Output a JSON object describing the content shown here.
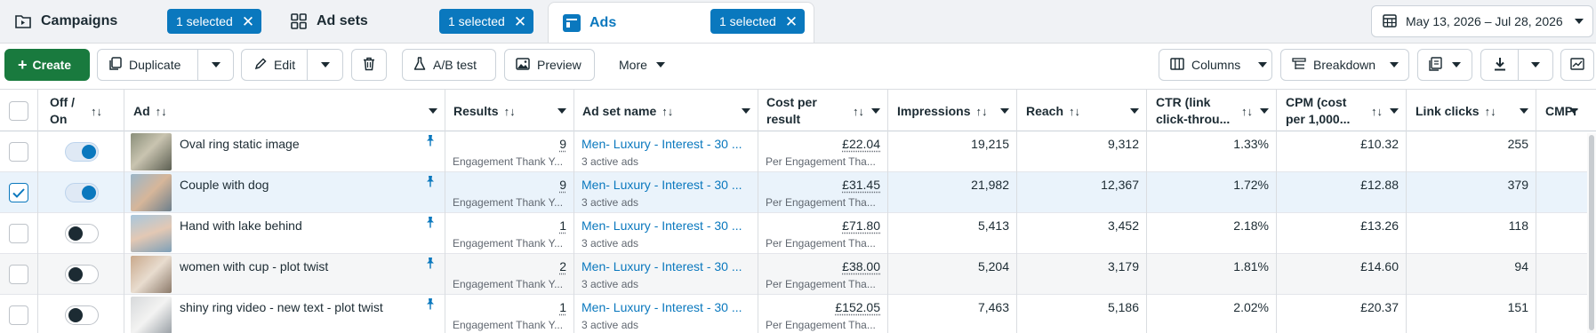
{
  "tabs": [
    {
      "label": "Campaigns",
      "selected_label": "1 selected"
    },
    {
      "label": "Ad sets",
      "selected_label": "1 selected"
    },
    {
      "label": "Ads",
      "selected_label": "1 selected"
    }
  ],
  "date_range": "May 13, 2026 – Jul 28, 2026",
  "toolbar": {
    "create": "Create",
    "duplicate": "Duplicate",
    "edit": "Edit",
    "ab_test": "A/B test",
    "preview": "Preview",
    "more": "More",
    "columns": "Columns",
    "breakdown": "Breakdown"
  },
  "columns": {
    "off_on_1": "Off /",
    "off_on_2": "On",
    "ad": "Ad",
    "results": "Results",
    "ad_set_name": "Ad set name",
    "cost_per_result_1": "Cost per",
    "cost_per_result_2": "result",
    "impressions": "Impressions",
    "reach": "Reach",
    "ctr_1": "CTR (link",
    "ctr_2": "click-throu...",
    "cpm_1": "CPM (cost",
    "cpm_2": "per 1,000...",
    "link_clicks": "Link clicks",
    "cmpr": "CMPr"
  },
  "rows": [
    {
      "ad": "Oval ring static image",
      "on": true,
      "checked": false,
      "results": "9",
      "results_sub": "Engagement Thank Y...",
      "ad_set": "Men- Luxury - Interest - 30 ...",
      "ad_set_sub": "3 active ads",
      "cost": "£22.04",
      "cost_sub": "Per Engagement Tha...",
      "impressions": "19,215",
      "reach": "9,312",
      "ctr": "1.33%",
      "cpm": "£10.32",
      "link_clicks": "255"
    },
    {
      "ad": "Couple with dog",
      "on": true,
      "checked": true,
      "results": "9",
      "results_sub": "Engagement Thank Y...",
      "ad_set": "Men- Luxury - Interest - 30 ...",
      "ad_set_sub": "3 active ads",
      "cost": "£31.45",
      "cost_sub": "Per Engagement Tha...",
      "impressions": "21,982",
      "reach": "12,367",
      "ctr": "1.72%",
      "cpm": "£12.88",
      "link_clicks": "379"
    },
    {
      "ad": "Hand with lake behind",
      "on": false,
      "checked": false,
      "results": "1",
      "results_sub": "Engagement Thank Y...",
      "ad_set": "Men- Luxury - Interest - 30 ...",
      "ad_set_sub": "3 active ads",
      "cost": "£71.80",
      "cost_sub": "Per Engagement Tha...",
      "impressions": "5,413",
      "reach": "3,452",
      "ctr": "2.18%",
      "cpm": "£13.26",
      "link_clicks": "118"
    },
    {
      "ad": "women with cup - plot twist",
      "on": false,
      "checked": false,
      "results": "2",
      "results_sub": "Engagement Thank Y...",
      "ad_set": "Men- Luxury - Interest - 30 ...",
      "ad_set_sub": "3 active ads",
      "cost": "£38.00",
      "cost_sub": "Per Engagement Tha...",
      "impressions": "5,204",
      "reach": "3,179",
      "ctr": "1.81%",
      "cpm": "£14.60",
      "link_clicks": "94"
    },
    {
      "ad": "shiny ring video - new text - plot twist",
      "on": false,
      "checked": false,
      "results": "1",
      "results_sub": "Engagement Thank Y...",
      "ad_set": "Men- Luxury - Interest - 30 ...",
      "ad_set_sub": "3 active ads",
      "cost": "£152.05",
      "cost_sub": "Per Engagement Tha...",
      "impressions": "7,463",
      "reach": "5,186",
      "ctr": "2.02%",
      "cpm": "£20.37",
      "link_clicks": "151"
    }
  ],
  "colors": {
    "accent": "#0a78be",
    "create": "#197a3e",
    "text": "#1c2b33",
    "muted": "#606770"
  }
}
